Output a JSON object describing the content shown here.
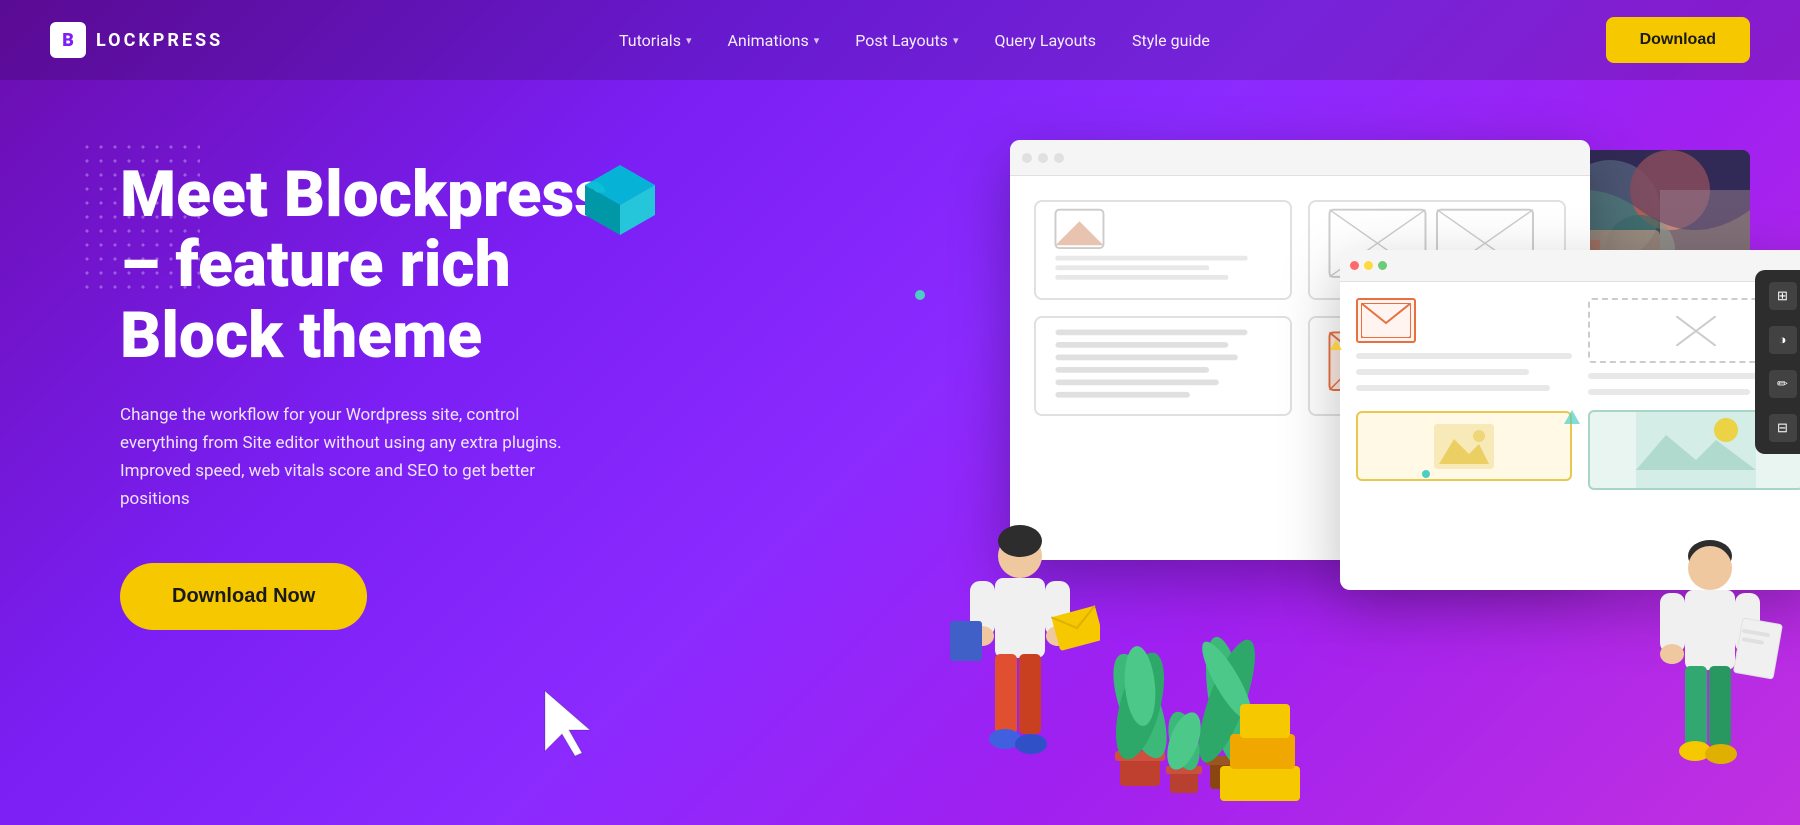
{
  "logo": {
    "icon_text": "B",
    "text": "LOCKPRESS"
  },
  "nav": {
    "links": [
      {
        "label": "Tutorials",
        "has_dropdown": true
      },
      {
        "label": "Animations",
        "has_dropdown": true
      },
      {
        "label": "Post Layouts",
        "has_dropdown": true
      },
      {
        "label": "Query Layouts",
        "has_dropdown": false
      },
      {
        "label": "Style guide",
        "has_dropdown": false
      }
    ],
    "download_label": "Download"
  },
  "hero": {
    "title_line1": "Meet Blockpress",
    "title_line2": "– feature rich",
    "title_line3": "Block theme",
    "subtitle": "Change the workflow for your Wordpress site, control everything from Site editor without using any extra plugins. Improved speed, web vitals score and SEO to get better positions",
    "cta_label": "Download Now"
  },
  "colors": {
    "background_start": "#6a0dad",
    "background_end": "#c030e0",
    "accent_yellow": "#f5c800",
    "accent_teal": "#4ecdc4",
    "accent_red": "#e87040",
    "browser_bg": "#ffffff",
    "panel_bg": "#2d2d2d"
  },
  "design_panel": {
    "icons": [
      "⊞",
      "◑",
      "✏",
      "⊟"
    ]
  }
}
